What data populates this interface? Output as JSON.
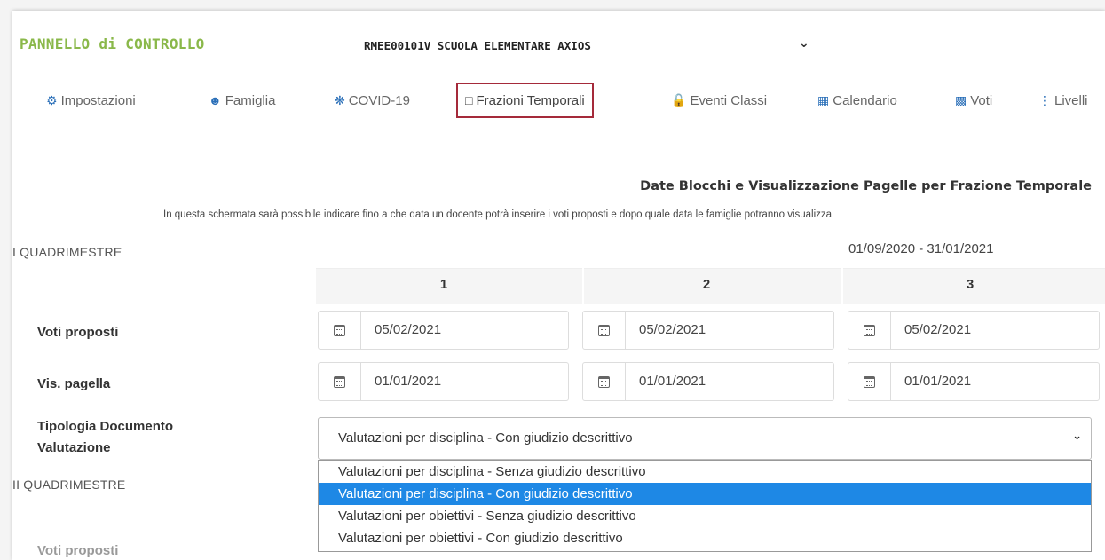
{
  "header": {
    "title": "PANNELLO di CONTROLLO",
    "school": "RMEE00101V SCUOLA ELEMENTARE AXIOS"
  },
  "nav": {
    "items": [
      {
        "label": "Impostazioni",
        "icon": "cogs-icon"
      },
      {
        "label": "Famiglia",
        "icon": "users-icon"
      },
      {
        "label": "COVID-19",
        "icon": "virus-icon"
      },
      {
        "label": "Frazioni Temporali",
        "icon": "calendar-outline-icon"
      },
      {
        "label": "Eventi Classi",
        "icon": "unlock-icon"
      },
      {
        "label": "Calendario",
        "icon": "calendar-icon"
      },
      {
        "label": "Voti",
        "icon": "table-icon"
      },
      {
        "label": "Livelli",
        "icon": "list-icon"
      }
    ],
    "active": "Frazioni Temporali"
  },
  "section": {
    "title": "Date Blocchi e Visualizzazione Pagelle per Frazione Temporale",
    "description": "In questa schermata sarà possibile indicare fino a che data un docente potrà inserire i voti proposti e dopo quale data le famiglie potranno visualizza"
  },
  "period1": {
    "label": "I QUADRIMESTRE",
    "range": "01/09/2020 - 31/01/2021",
    "columns": [
      "1",
      "2",
      "3"
    ],
    "voti_proposti_label": "Voti proposti",
    "voti_proposti": [
      "05/02/2021",
      "05/02/2021",
      "05/02/2021"
    ],
    "vis_pagella_label": "Vis. pagella",
    "vis_pagella": [
      "01/01/2021",
      "01/01/2021",
      "01/01/2021"
    ],
    "tipologia_label_1": "Tipologia Documento",
    "tipologia_label_2": "Valutazione",
    "tipologia_value": "Valutazioni per disciplina - Con giudizio descrittivo",
    "tipologia_options": [
      "Valutazioni per disciplina - Senza giudizio descrittivo",
      "Valutazioni per disciplina - Con giudizio descrittivo",
      "Valutazioni per obiettivi - Senza giudizio descrittivo",
      "Valutazioni per obiettivi - Con giudizio descrittivo"
    ]
  },
  "period2": {
    "label": "II QUADRIMESTRE",
    "voti_proposti_label": "Voti proposti"
  },
  "colors": {
    "title_green": "#8ab84a",
    "nav_blue": "#2a6fb8",
    "active_border": "#a52a3a",
    "selected_option": "#1e88e5"
  }
}
